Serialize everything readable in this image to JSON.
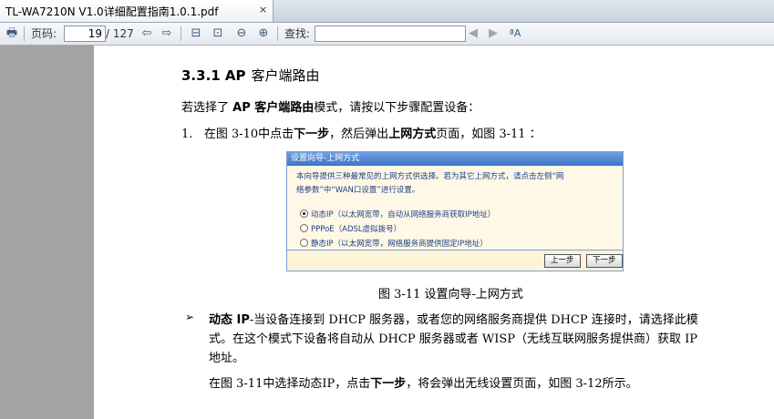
{
  "tab": {
    "title": "TL-WA7210N  V1.0详细配置指南1.0.1.pdf",
    "close": "×"
  },
  "toolbar": {
    "page_label": "页码:",
    "page_current": "19",
    "page_total": "/ 127",
    "find_label": "查找:",
    "find_value": ""
  },
  "doc": {
    "heading_num": "3.3.1  AP",
    "heading_text": "客户端路由",
    "intro_pre": "若选择了 ",
    "intro_bold": "AP 客户端路由",
    "intro_post": "模式，请按以下步骤配置设备：",
    "step_num": "1.",
    "step_pre": "在图  3-10中点击",
    "step_bold1": "下一步",
    "step_mid": "，然后弹出",
    "step_bold2": "上网方式",
    "step_post": "页面，如图  3-11 ：",
    "caption": "图  3-11  设置向导-上网方式",
    "bullet_symbol": "➢",
    "bullet_bold": "动态 IP",
    "bullet_line1": "-当设备连接到 DHCP 服务器，或者您的网络服务商提供 DHCP 连接时，请选择此模",
    "bullet_line2": "式。在这个模式下设备将自动从 DHCP 服务器或者 WISP（无线互联网服务提供商）获取 IP",
    "bullet_line3": "地址。",
    "last_pre": "在图  3-11中选择动态IP，点击",
    "last_bold": "下一步",
    "last_post": "，将会弹出无线设置页面，如图  3-12所示。"
  },
  "dialog": {
    "title": "设置向导-上网方式",
    "desc_line1": "本向导提供三种最常见的上网方式供选择。若为其它上网方式，请点击左侧“网",
    "desc_line2": "络参数”中“WAN口设置”进行设置。",
    "options": [
      {
        "label": "动态IP（以太网宽带，自动从网络服务商获取IP地址）",
        "selected": true
      },
      {
        "label": "PPPoE（ADSL虚拟拨号）",
        "selected": false
      },
      {
        "label": "静态IP（以太网宽带，网络服务商提供固定IP地址）",
        "selected": false
      }
    ],
    "prev_button": "上一步",
    "next_button": "下一步"
  }
}
